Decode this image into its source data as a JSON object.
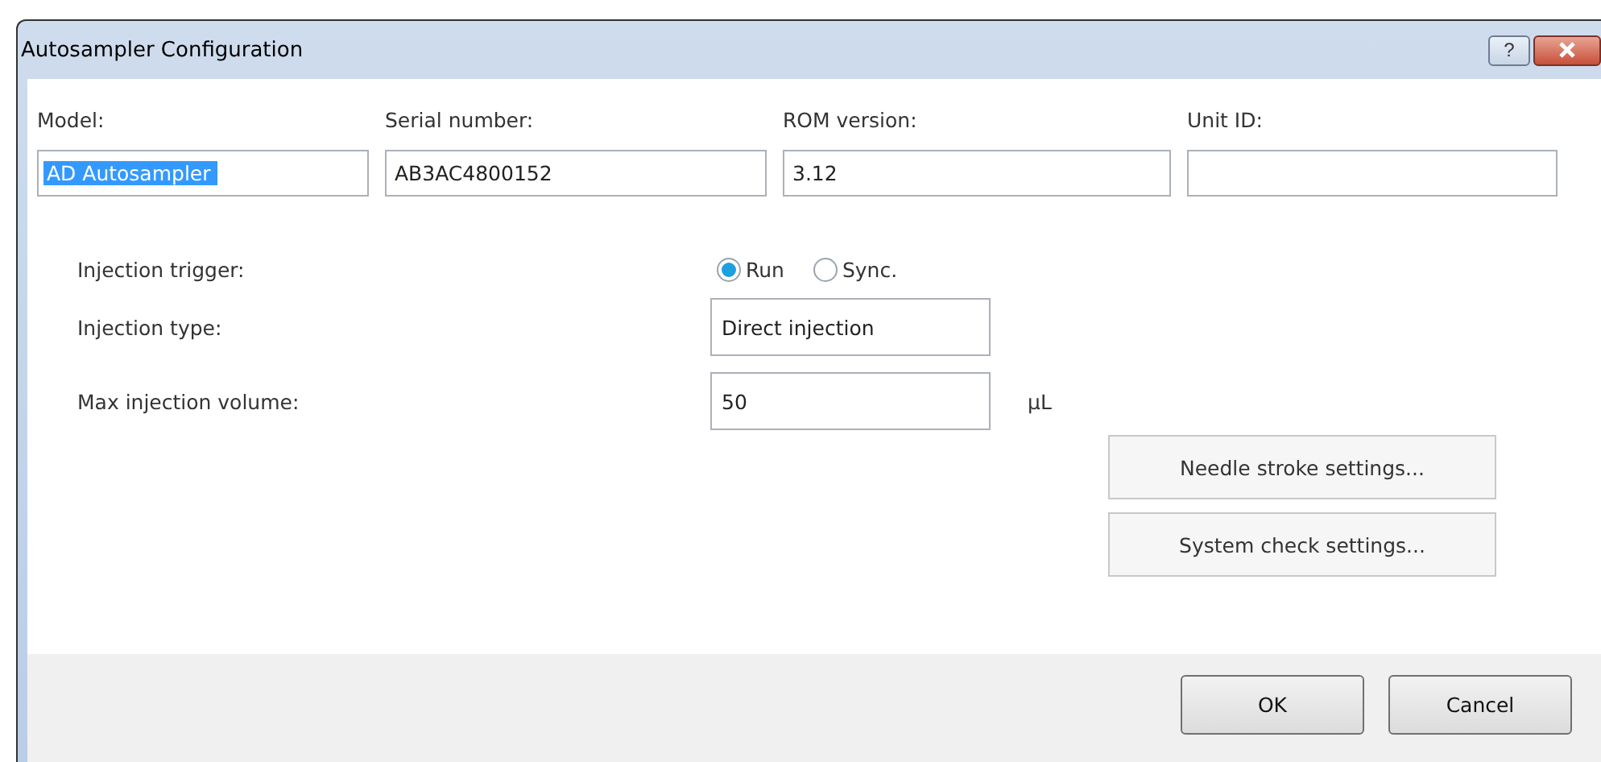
{
  "window": {
    "title": "Autosampler Configuration",
    "buttons": [
      {
        "kind": "help",
        "label": "?"
      },
      {
        "kind": "close"
      }
    ]
  },
  "info_fields": [
    {
      "label": "Model:",
      "value": "AD Autosampler",
      "text_selected": true
    },
    {
      "label": "Serial number:",
      "value": "AB3AC4800152",
      "text_selected": false
    },
    {
      "label": "ROM version:",
      "value": "3.12",
      "text_selected": false
    },
    {
      "label": "Unit ID:"
    }
  ],
  "injection_trigger": {
    "label": "Injection trigger:",
    "options": [
      {
        "label": "Run",
        "selected": true
      },
      {
        "label": "Sync.",
        "selected": false
      }
    ]
  },
  "injection_type": {
    "label": "Injection type:",
    "value": "Direct injection"
  },
  "max_injection_volume": {
    "label": "Max injection volume:",
    "value": "50",
    "unit": "µL"
  },
  "settings_buttons": [
    "Needle stroke settings...",
    "System check settings..."
  ],
  "footer_buttons": [
    "OK",
    "Cancel"
  ]
}
